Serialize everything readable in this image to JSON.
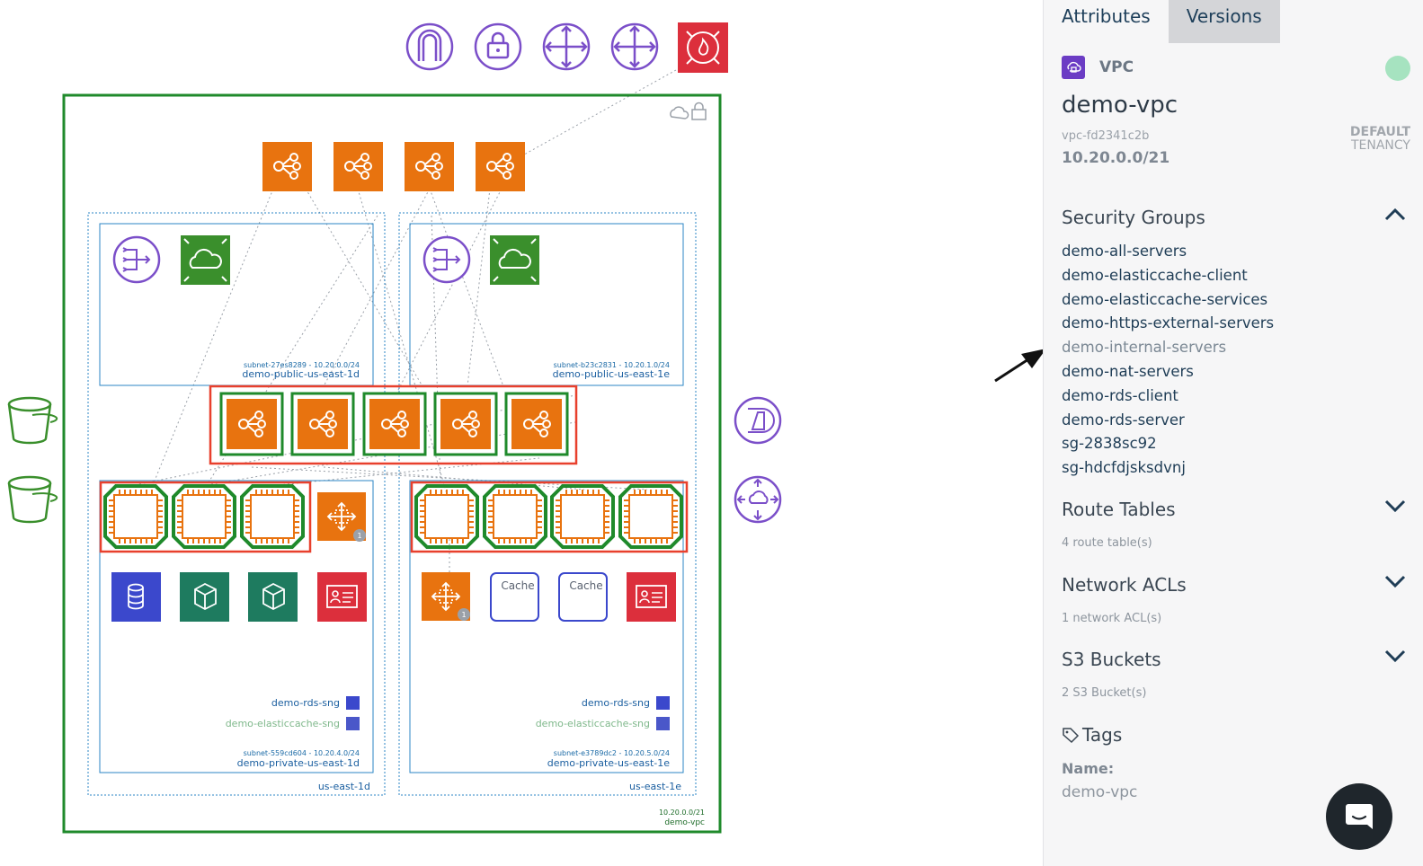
{
  "diagram": {
    "vpc_cidr": "10.20.0.0/21",
    "vpc_name": "demo-vpc",
    "az_left": "us-east-1d",
    "az_right": "us-east-1e",
    "subnets": {
      "public_1d_id": "subnet-27es8289 - 10.20.0.0/24",
      "public_1d_name": "demo-public-us-east-1d",
      "public_1e_id": "subnet-b23c2831 - 10.20.1.0/24",
      "public_1e_name": "demo-public-us-east-1e",
      "private_1d_id": "subnet-559cd604 - 10.20.4.0/24",
      "private_1d_name": "demo-private-us-east-1d",
      "private_1e_id": "subnet-e3789dc2 - 10.20.5.0/24",
      "private_1e_name": "demo-private-us-east-1e"
    },
    "sng_rds": "demo-rds-sng",
    "sng_cache": "demo-elasticcache-sng",
    "cache_label": "Cache",
    "badge_count": "1"
  },
  "tabs": [
    {
      "label": "Attributes",
      "active": true
    },
    {
      "label": "Versions",
      "active": false
    }
  ],
  "panel": {
    "resource_type": "VPC",
    "title": "demo-vpc",
    "vpc_id": "vpc-fd2341c2b",
    "cidr": "10.20.0.0/21",
    "tenancy_line1": "DEFAULT",
    "tenancy_line2": "TENANCY",
    "security_groups": {
      "heading": "Security Groups",
      "expanded": true,
      "items": [
        "demo-all-servers",
        "demo-elasticcache-client",
        "demo-elasticcache-services",
        "demo-https-external-servers",
        "demo-internal-servers",
        "demo-nat-servers",
        "demo-rds-client",
        "demo-rds-server",
        "sg-2838sc92",
        "sg-hdcfdjsksdvnj"
      ],
      "highlighted": "demo-internal-servers"
    },
    "route_tables": {
      "heading": "Route Tables",
      "summary": "4 route table(s)"
    },
    "network_acls": {
      "heading": "Network ACLs",
      "summary": "1 network ACL(s)"
    },
    "s3_buckets": {
      "heading": "S3 Buckets",
      "summary": "2 S3 Bucket(s)"
    },
    "tags": {
      "heading": "Tags",
      "name_key": "Name:",
      "name_value": "demo-vpc"
    }
  },
  "colors": {
    "vpc_border": "#1f8a2b",
    "subnet_border": "#2b86c5",
    "selection": "#e8402d",
    "elb_orange": "#e8730f",
    "nat_purple": "#7b4fc9",
    "firewall_red": "#dc2f3c",
    "status_green": "#a6e3c0"
  }
}
